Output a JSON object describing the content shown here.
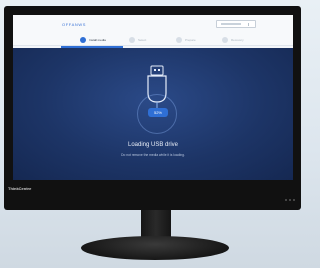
{
  "topbar": {
    "brand": "OFFANWS",
    "steps": [
      "Install media",
      "Select",
      "Prepare",
      "Recovery"
    ]
  },
  "progress": {
    "percent_label": "52%",
    "value": 0.52
  },
  "main": {
    "title": "Loading USB drive",
    "subtitle": "Do not remove the media while it is loading."
  },
  "device": {
    "logo": "ThinkCentre"
  },
  "icons": [
    "usb-drive-icon"
  ],
  "colors": {
    "accent": "#2f6fd5",
    "panel": "#1d3567"
  }
}
